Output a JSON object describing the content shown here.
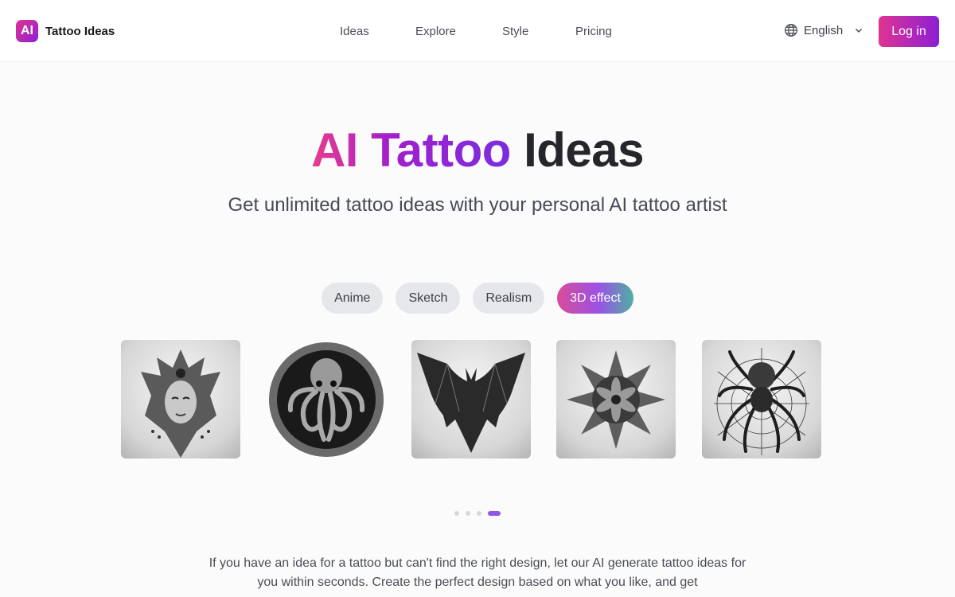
{
  "header": {
    "logo_text": "AI",
    "brand_name": "Tattoo Ideas",
    "nav": [
      {
        "label": "Ideas"
      },
      {
        "label": "Explore"
      },
      {
        "label": "Style"
      },
      {
        "label": "Pricing"
      }
    ],
    "language": {
      "icon": "globe-icon",
      "label": "English",
      "chevron": "chevron-down-icon"
    },
    "login_label": "Log in"
  },
  "hero": {
    "title_gradient": "AI Tattoo",
    "title_plain": "Ideas",
    "subtitle": "Get unlimited tattoo ideas with your personal AI tattoo artist"
  },
  "styles": {
    "chips": [
      {
        "label": "Anime",
        "active": false
      },
      {
        "label": "Sketch",
        "active": false
      },
      {
        "label": "Realism",
        "active": false
      },
      {
        "label": "3D effect",
        "active": true
      }
    ]
  },
  "gallery": {
    "images": [
      {
        "subject": "goddess face with ornate headdress"
      },
      {
        "subject": "octopus / cthulhu emblem"
      },
      {
        "subject": "bat with spread wings"
      },
      {
        "subject": "mandala flower"
      },
      {
        "subject": "spider on web"
      }
    ]
  },
  "carousel": {
    "pages": 4,
    "current_page": 4
  },
  "description": "If you have an idea for a tattoo but can't find the right design, let our AI generate tattoo ideas for you within seconds. Create the perfect design based on what you like, and get",
  "colors": {
    "brand_gradient_start": "#e0338f",
    "brand_gradient_end": "#8e1fd6",
    "active_dot": "#9057e8",
    "chip_bg": "#e6e7ea"
  }
}
